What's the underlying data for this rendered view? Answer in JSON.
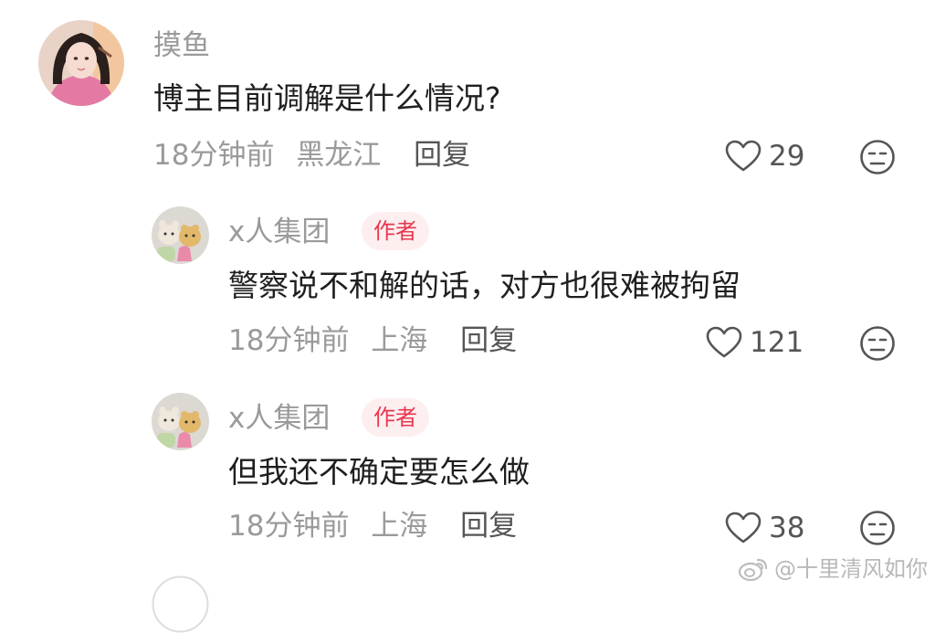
{
  "comments": [
    {
      "username": "摸鱼",
      "text": "博主目前调解是什么情况?",
      "time": "18分钟前",
      "location": "黑龙江",
      "reply_label": "回复",
      "likes": "29"
    },
    {
      "username": "x人集团",
      "badge": "作者",
      "text": "警察说不和解的话，对方也很难被拘留",
      "time": "18分钟前",
      "location": "上海",
      "reply_label": "回复",
      "likes": "121"
    },
    {
      "username": "x人集团",
      "badge": "作者",
      "text": "但我还不确定要怎么做",
      "time": "18分钟前",
      "location": "上海",
      "reply_label": "回复",
      "likes": "38"
    }
  ],
  "watermark": "@十里清风如你",
  "icons": {
    "like": "heart-outline-icon",
    "dislike": "unamused-face-icon",
    "watermark": "weibo-logo-icon"
  },
  "colors": {
    "badge_text": "#e8384e",
    "badge_bg": "#fdeef0",
    "username": "#9a9a9a",
    "text": "#1f1f1f"
  }
}
